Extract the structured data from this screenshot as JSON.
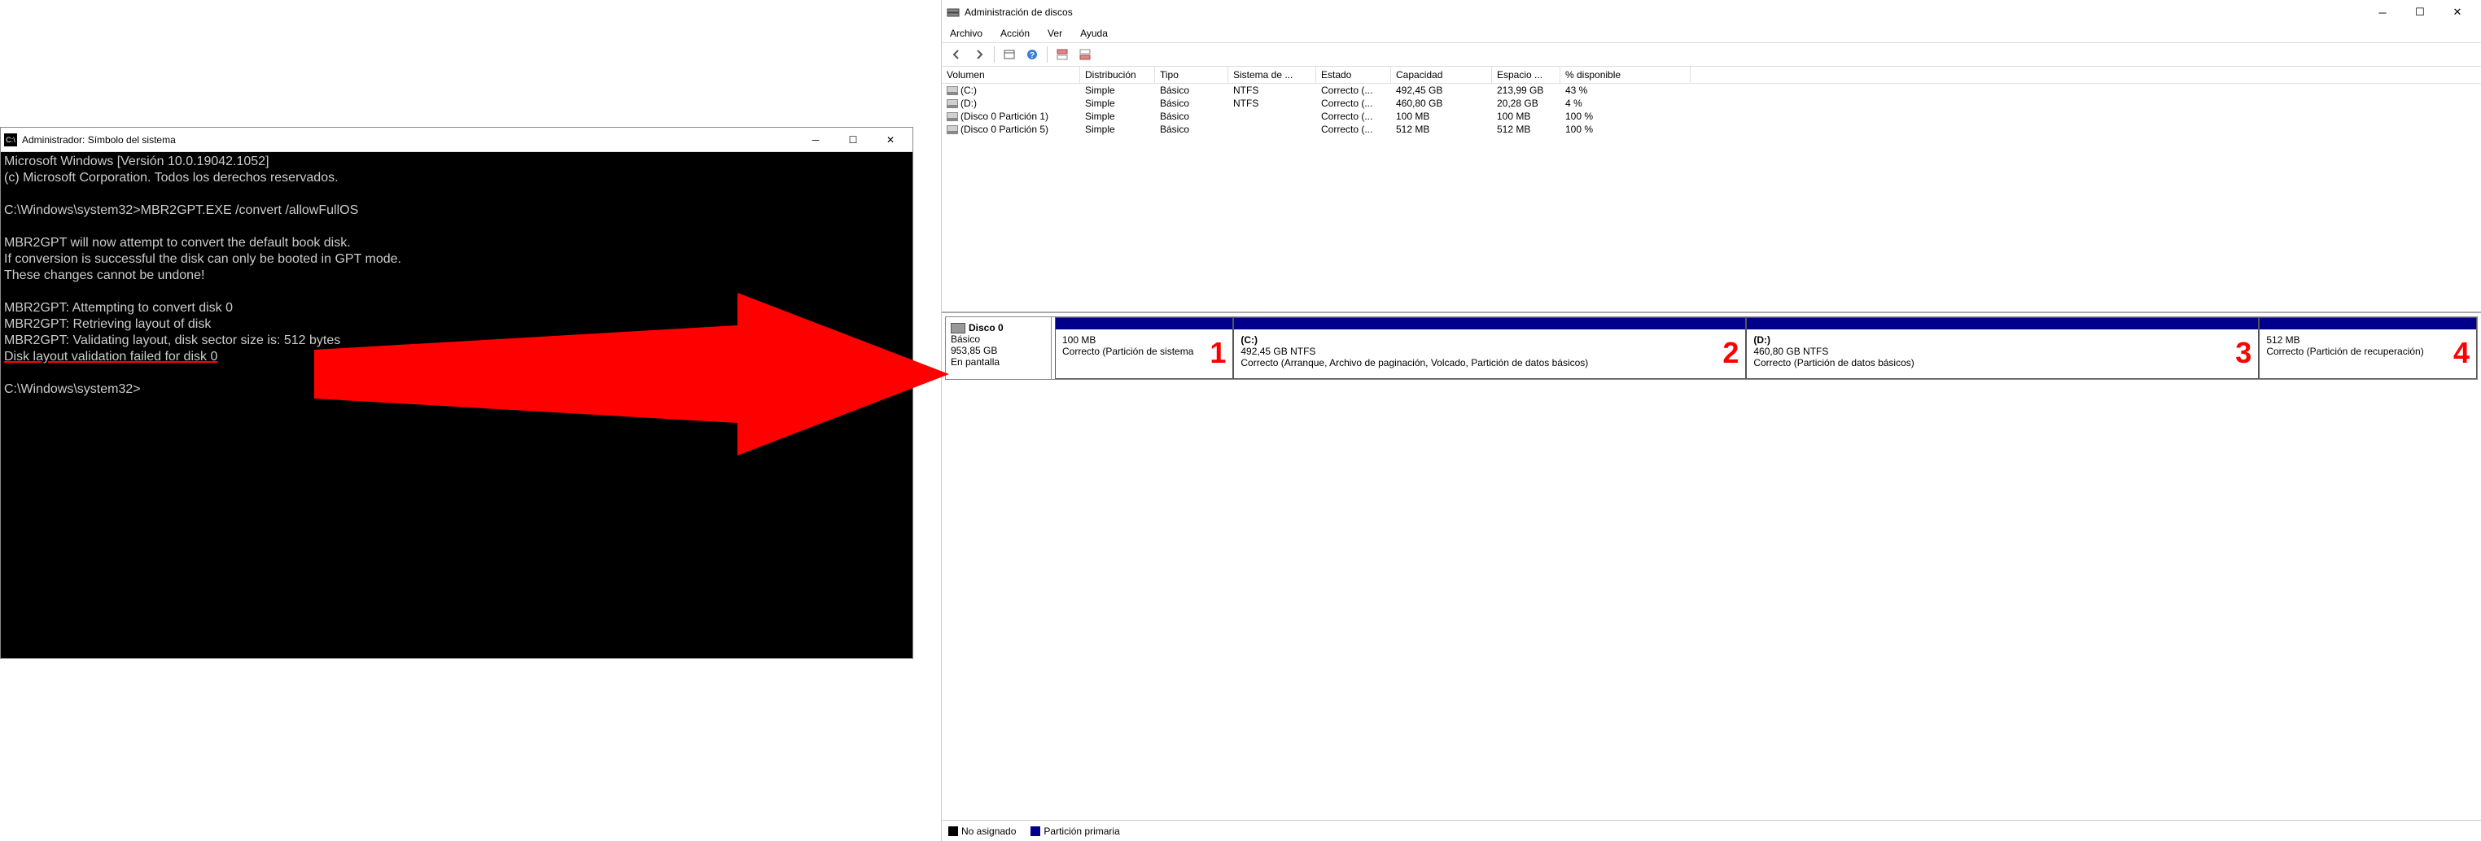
{
  "cmd": {
    "title": "Administrador: Símbolo del sistema",
    "lines": [
      "Microsoft Windows [Versión 10.0.19042.1052]",
      "(c) Microsoft Corporation. Todos los derechos reservados.",
      "",
      "C:\\Windows\\system32>MBR2GPT.EXE /convert /allowFullOS",
      "",
      "MBR2GPT will now attempt to convert the default book disk.",
      "If conversion is successful the disk can only be booted in GPT mode.",
      "These changes cannot be undone!",
      "",
      "MBR2GPT: Attempting to convert disk 0",
      "MBR2GPT: Retrieving layout of disk",
      "MBR2GPT: Validating layout, disk sector size is: 512 bytes"
    ],
    "error_line": "Disk layout validation failed for disk 0",
    "prompt": "C:\\Windows\\system32>"
  },
  "dm": {
    "title": "Administración de discos",
    "menu": {
      "archivo": "Archivo",
      "accion": "Acción",
      "ver": "Ver",
      "ayuda": "Ayuda"
    },
    "columns": {
      "volumen": "Volumen",
      "distribucion": "Distribución",
      "tipo": "Tipo",
      "sistema": "Sistema de ...",
      "estado": "Estado",
      "capacidad": "Capacidad",
      "espacio": "Espacio ...",
      "disponible": "% disponible"
    },
    "rows": [
      {
        "vol": "(C:)",
        "dist": "Simple",
        "tipo": "Básico",
        "fs": "NTFS",
        "estado": "Correcto (...",
        "cap": "492,45 GB",
        "free": "213,99 GB",
        "pct": "43 %"
      },
      {
        "vol": "(D:)",
        "dist": "Simple",
        "tipo": "Básico",
        "fs": "NTFS",
        "estado": "Correcto (...",
        "cap": "460,80 GB",
        "free": "20,28 GB",
        "pct": "4 %"
      },
      {
        "vol": "(Disco 0 Partición 1)",
        "dist": "Simple",
        "tipo": "Básico",
        "fs": "",
        "estado": "Correcto (...",
        "cap": "100 MB",
        "free": "100 MB",
        "pct": "100 %"
      },
      {
        "vol": "(Disco 0 Partición 5)",
        "dist": "Simple",
        "tipo": "Básico",
        "fs": "",
        "estado": "Correcto (...",
        "cap": "512 MB",
        "free": "512 MB",
        "pct": "100 %"
      }
    ],
    "disk": {
      "name": "Disco 0",
      "type": "Básico",
      "size": "953,85 GB",
      "status": "En pantalla",
      "parts": [
        {
          "title": "",
          "line2": "100 MB",
          "line3": "Correcto (Partición de sistema",
          "num": "1",
          "flex": "0.9"
        },
        {
          "title": "(C:)",
          "line2": "492,45 GB NTFS",
          "line3": "Correcto (Arranque, Archivo de paginación, Volcado, Partición de datos básicos)",
          "num": "2",
          "flex": "2.6"
        },
        {
          "title": "(D:)",
          "line2": "460,80 GB NTFS",
          "line3": "Correcto (Partición de datos básicos)",
          "num": "3",
          "flex": "2.6"
        },
        {
          "title": "",
          "line2": "512 MB",
          "line3": "Correcto (Partición de recuperación)",
          "num": "4",
          "flex": "1.1"
        }
      ]
    },
    "legend": {
      "unalloc": "No asignado",
      "primary": "Partición primaria"
    }
  }
}
